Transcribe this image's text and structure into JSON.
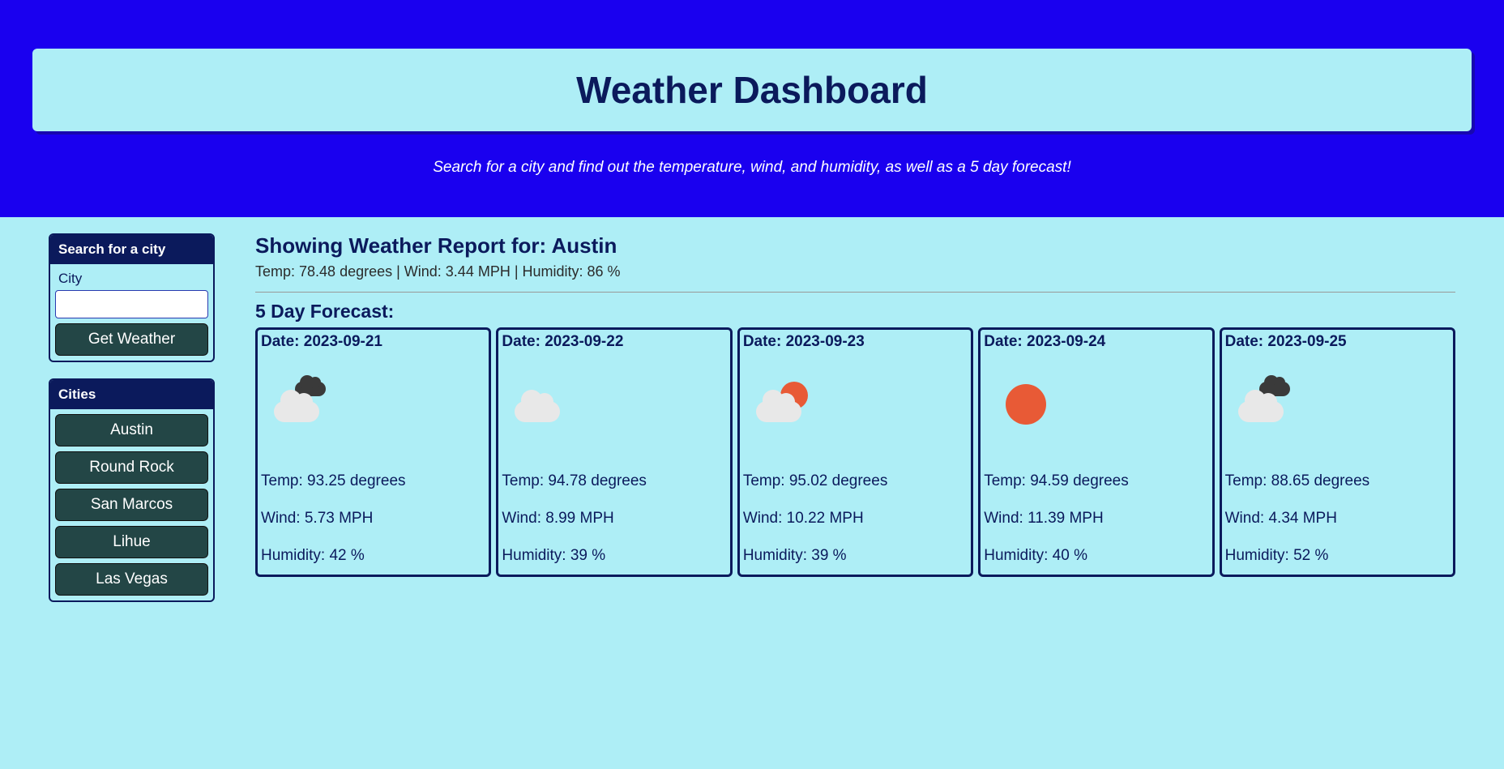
{
  "header": {
    "title": "Weather Dashboard",
    "subtitle": "Search for a city and find out the temperature, wind, and humidity, as well as a 5 day forecast!"
  },
  "search": {
    "panel_title": "Search for a city",
    "field_label": "City",
    "input_value": "",
    "button_label": "Get Weather"
  },
  "cities": {
    "panel_title": "Cities",
    "items": [
      "Austin",
      "Round Rock",
      "San Marcos",
      "Lihue",
      "Las Vegas"
    ]
  },
  "report": {
    "title": "Showing Weather Report for: Austin",
    "current_line": "Temp: 78.48 degrees | Wind: 3.44 MPH | Humidity: 86 %",
    "forecast_title": "5 Day Forecast:",
    "days": [
      {
        "date_label": "Date: 2023-09-21",
        "icon": "cloud-dark",
        "temp": "Temp: 93.25 degrees",
        "wind": "Wind: 5.73 MPH",
        "humidity": "Humidity: 42 %"
      },
      {
        "date_label": "Date: 2023-09-22",
        "icon": "cloud",
        "temp": "Temp: 94.78 degrees",
        "wind": "Wind: 8.99 MPH",
        "humidity": "Humidity: 39 %"
      },
      {
        "date_label": "Date: 2023-09-23",
        "icon": "cloud-sun",
        "temp": "Temp: 95.02 degrees",
        "wind": "Wind: 10.22 MPH",
        "humidity": "Humidity: 39 %"
      },
      {
        "date_label": "Date: 2023-09-24",
        "icon": "sun",
        "temp": "Temp: 94.59 degrees",
        "wind": "Wind: 11.39 MPH",
        "humidity": "Humidity: 40 %"
      },
      {
        "date_label": "Date: 2023-09-25",
        "icon": "cloud-dark",
        "temp": "Temp: 88.65 degrees",
        "wind": "Wind: 4.34 MPH",
        "humidity": "Humidity: 52 %"
      }
    ]
  }
}
